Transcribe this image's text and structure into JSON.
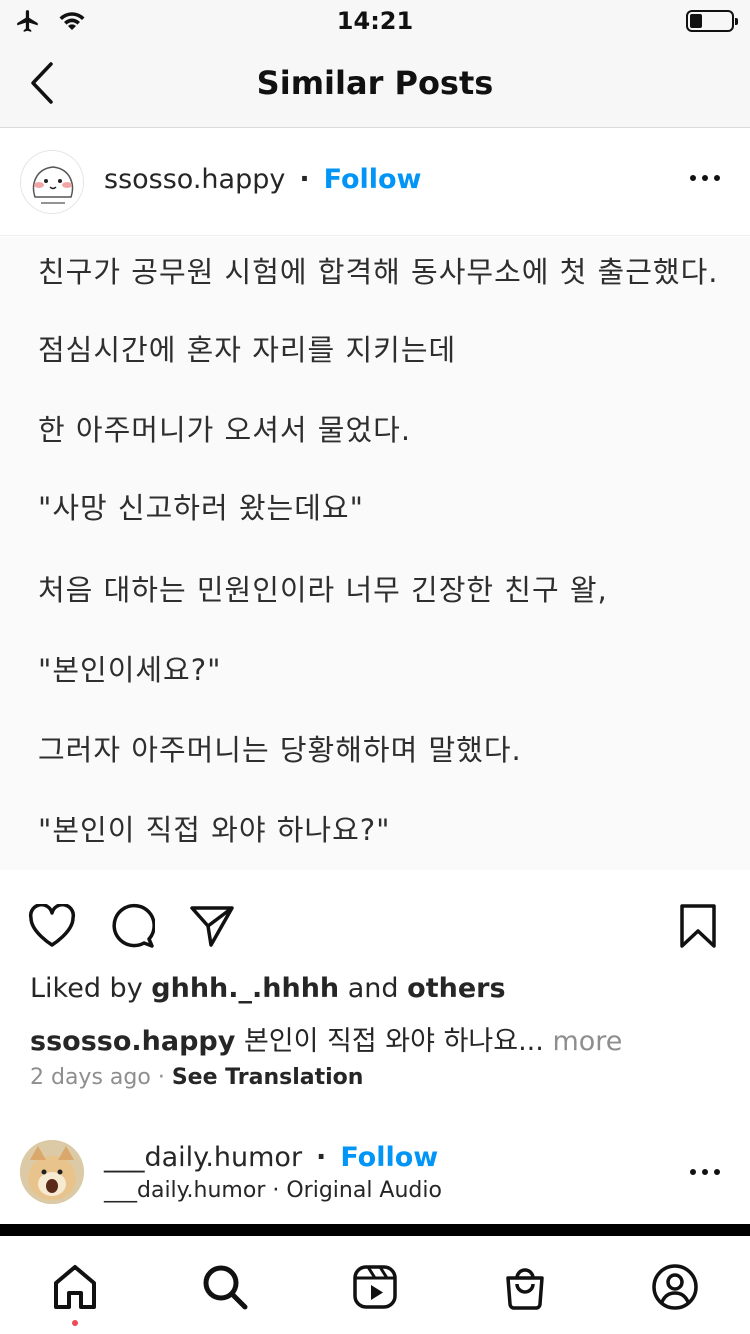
{
  "status": {
    "time": "14:21",
    "battery_level": 0.3
  },
  "nav": {
    "title": "Similar Posts"
  },
  "post": {
    "username": "ssosso.happy",
    "follow_label": "Follow",
    "separator": "·",
    "lines": [
      "친구가 공무원 시험에 합격해 동사무소에 첫 출근했다.",
      "점심시간에 혼자 자리를 지키는데",
      "한 아주머니가 오셔서 물었다.",
      "\"사망 신고하러 왔는데요\"",
      "처음 대하는 민원인이라 너무 긴장한 친구 왈,",
      "\"본인이세요?\"",
      "그러자 아주머니는 당황해하며 말했다.",
      "\"본인이 직접 와야 하나요?\""
    ],
    "liked_prefix": "Liked by",
    "liked_user": "ghhh._.hhhh",
    "liked_and": "and",
    "liked_others": "others",
    "caption_user": "ssosso.happy",
    "caption_text": "본인이 직접 와야 하나요...",
    "caption_more": "more",
    "time_ago": "2 days ago",
    "meta_sep": "·",
    "see_translation": "See Translation"
  },
  "next_post": {
    "username": "___daily.humor",
    "follow_label": "Follow",
    "separator": "·",
    "audio": "___daily.humor · Original Audio"
  },
  "colors": {
    "accent": "#0095f6",
    "notification_dot": "#ed4956"
  },
  "icons": [
    "airplane-icon",
    "wifi-icon",
    "back-chevron-icon",
    "more-icon",
    "heart-icon",
    "comment-icon",
    "share-icon",
    "bookmark-icon",
    "home-icon",
    "search-icon",
    "reels-icon",
    "shop-icon",
    "profile-icon"
  ]
}
